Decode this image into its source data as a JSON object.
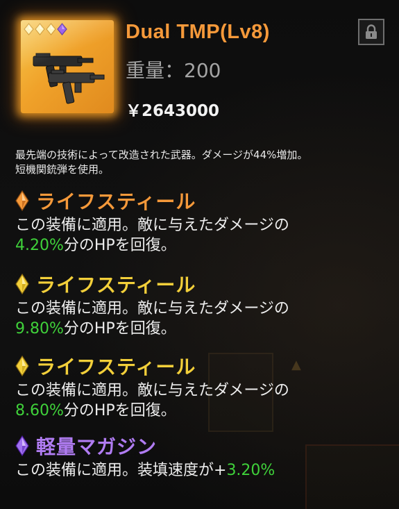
{
  "item": {
    "name": "Dual TMP(Lv8)",
    "weight_label": "重量：200",
    "price_label": "￥2643000",
    "rarity_pips": [
      "gold",
      "gold",
      "gold",
      "purple"
    ],
    "icon": "dual-tmp-weapon-icon"
  },
  "lock": {
    "icon": "lock-icon"
  },
  "description": {
    "line1": "最先端の技術によって改造された武器。ダメージが44%増加。",
    "line2": "短機関銃弾を使用。"
  },
  "perks": [
    {
      "title": "ライフスティール",
      "gem_color": "#f5993a",
      "line1": "この装備に適用。敵に与えたダメージの",
      "value": "4.20%",
      "suffix": "分のHPを回復。"
    },
    {
      "title": "ライフスティール",
      "gem_color": "#f2cf3a",
      "line1": "この装備に適用。敵に与えたダメージの",
      "value": "9.80%",
      "suffix": "分のHPを回復。"
    },
    {
      "title": "ライフスティール",
      "gem_color": "#f2cf3a",
      "line1": "この装備に適用。敵に与えたダメージの",
      "value": "8.60%",
      "suffix": "分のHPを回復。"
    },
    {
      "title": "軽量マガジン",
      "gem_color": "#a070f0",
      "prefix": "この装備に適用。装填速度が+",
      "value": "3.20%"
    }
  ],
  "colors": {
    "orange": "#f5993a",
    "yellow": "#f2cf3a",
    "purple": "#b07cf2",
    "green": "#3fd13a"
  }
}
